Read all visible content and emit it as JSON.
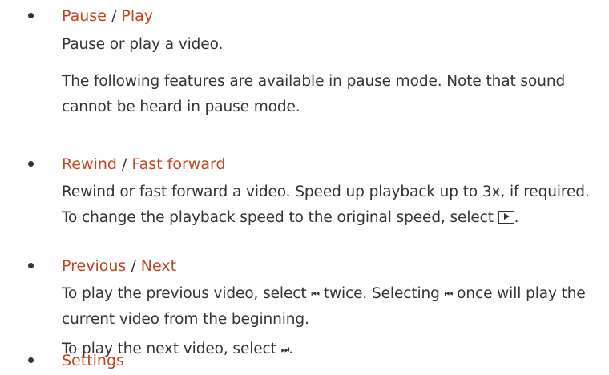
{
  "colors": {
    "heading": "#c0441d",
    "text": "#333333"
  },
  "items": [
    {
      "title": [
        "Pause",
        "Play"
      ],
      "separator": "/",
      "paragraphs": [
        "Pause or play a video.",
        "The following features are available in pause mode. Note that sound cannot be heard in pause mode."
      ]
    },
    {
      "title": [
        "Rewind",
        "Fast forward"
      ],
      "separator": "/",
      "paragraphs": [
        "Rewind or fast forward a video. Speed up playback up to 3x, if required. To change the playback speed to the original speed, select",
        "."
      ],
      "icon": "play-button-icon"
    },
    {
      "title": [
        "Previous",
        "Next"
      ],
      "separator": "/",
      "paragraphs": [
        "To play the previous video, select",
        "twice. Selecting",
        "once will play the current video from the beginning.",
        "To play the next video, select",
        "."
      ],
      "icons": [
        "previous-track-icon",
        "next-track-icon"
      ],
      "glyphs": {
        "previous": "⏮",
        "next": "⏭"
      }
    },
    {
      "title": [
        "Settings"
      ]
    }
  ]
}
